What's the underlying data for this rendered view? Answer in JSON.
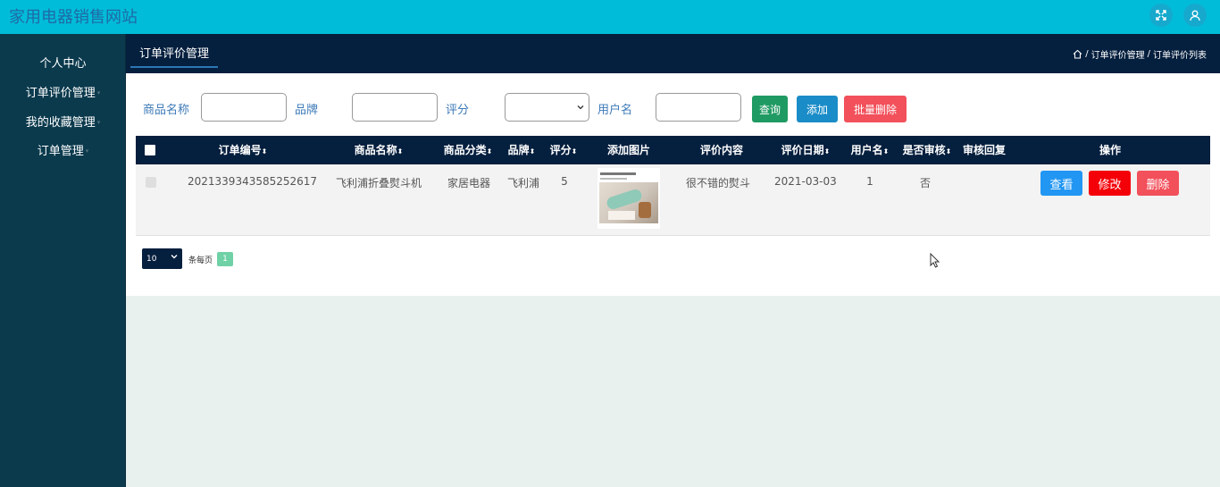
{
  "header": {
    "site_title": "家用电器销售网站",
    "fullscreen_icon": "expand-icon",
    "user_icon": "user-icon"
  },
  "sidebar": {
    "items": [
      {
        "label": "个人中心",
        "caret": ""
      },
      {
        "label": "订单评价管理",
        "caret": "▾"
      },
      {
        "label": "我的收藏管理",
        "caret": "▾"
      },
      {
        "label": "订单管理",
        "caret": "▾"
      }
    ]
  },
  "nav": {
    "tab": "订单评价管理",
    "breadcrumb": {
      "home_icon": "home-icon",
      "sep1": "/",
      "level1": "订单评价管理",
      "sep2": "/",
      "level2": "订单评价列表"
    }
  },
  "filters": {
    "product_name_label": "商品名称",
    "product_name_value": "",
    "brand_label": "品牌",
    "brand_value": "",
    "rating_label": "评分",
    "rating_value": "",
    "username_label": "用户名",
    "username_value": "",
    "query_label": "查询",
    "add_label": "添加",
    "batch_delete_label": "批量删除"
  },
  "table": {
    "columns": [
      "订单编号",
      "商品名称",
      "商品分类",
      "品牌",
      "评分",
      "添加图片",
      "评价内容",
      "评价日期",
      "用户名",
      "是否审核",
      "审核回复",
      "操作"
    ],
    "sort_glyph": "⬍",
    "rows": [
      {
        "order_no": "2021339343585252617",
        "product_name": "飞利浦折叠熨斗机",
        "category": "家居电器",
        "brand": "飞利浦",
        "rating": "5",
        "image": "product-thumbnail",
        "comment": "很不错的熨斗",
        "date": "2021-03-03",
        "username": "1",
        "reviewed": "否",
        "reply": ""
      }
    ],
    "actions": {
      "view": "查看",
      "edit": "修改",
      "delete": "删除"
    }
  },
  "pagination": {
    "page_size": "10",
    "per_page_label": "条每页",
    "current_page": "1"
  },
  "colors": {
    "topbar": "#00bcd9",
    "sidebar": "#0b3a4d",
    "navbar": "#051f3e",
    "content_bg": "#e8f1ed",
    "query": "#1f9a63",
    "add": "#1a8cc8",
    "batch_delete": "#f2505b",
    "view": "#2196f3",
    "edit": "#f40009",
    "delete": "#f2505b",
    "page_active": "#6fd1a6"
  }
}
